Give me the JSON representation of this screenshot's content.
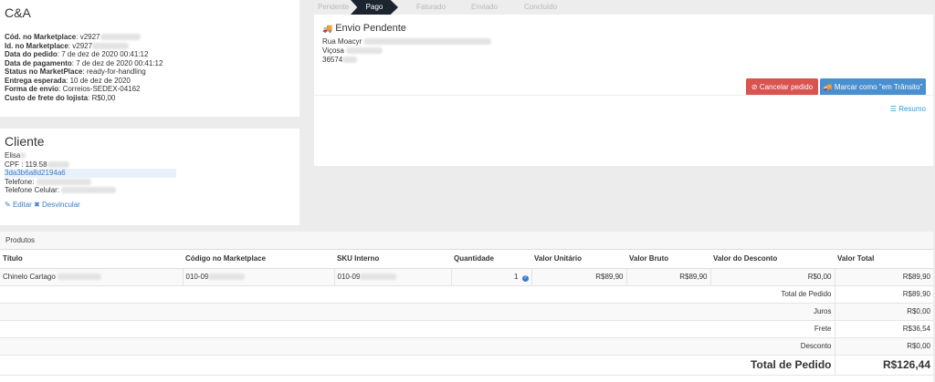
{
  "order": {
    "title": "C&A",
    "fields": [
      {
        "label": "Cód. no Marketplace",
        "value": "v2927"
      },
      {
        "label": "Id. no Marketplace",
        "value": "v2927"
      },
      {
        "label": "Data do pedido",
        "value": "7 de dez de 2020 00:41:12"
      },
      {
        "label": "Data de pagamento",
        "value": "7 de dez de 2020 00:41:12"
      },
      {
        "label": "Status no MarketPlace",
        "value": "ready-for-handling"
      },
      {
        "label": "Entrega esperada",
        "value": "10 de dez de 2020"
      },
      {
        "label": "Forma de envio",
        "value": "Correios-SEDEX-04162"
      },
      {
        "label": "Custo de frete do lojista",
        "value": "R$0,00"
      }
    ]
  },
  "client": {
    "title": "Cliente",
    "name": "Elisa",
    "cpf_label": "CPF",
    "cpf_value": "119.58",
    "id_link": "3da3b6a8d2194a6",
    "phone_label": "Telefone",
    "cell_label": "Telefone Celular",
    "edit_label": "Editar",
    "unlink_label": "Desvincular"
  },
  "steps": [
    "Pendente",
    "Pago",
    "Faturado",
    "Enviado",
    "Concluído"
  ],
  "shipping": {
    "title": "Envio Pendente",
    "address_line1": "Rua Moacyr",
    "address_line2": "Viçosa",
    "address_line3": "36574",
    "cancel_label": "Cancelar pedido",
    "transit_label": "Marcar como \"em Trânsito\"",
    "resumo_label": "Resumo"
  },
  "products": {
    "section_title": "Produtos",
    "columns": [
      "Título",
      "Código no Marketplace",
      "SKU Interno",
      "Quantidade",
      "Valor Unitário",
      "Valor Bruto",
      "Valor do Desconto",
      "Valor Total"
    ],
    "row": {
      "title": "Chinelo Cartago",
      "code": "010-09",
      "sku": "010-09",
      "qty": "1",
      "unit": "R$89,90",
      "gross": "R$89,90",
      "discount": "R$0,00",
      "total": "R$89,90"
    },
    "summary": [
      {
        "label": "Total de Pedido",
        "value": "R$89,90"
      },
      {
        "label": "Juros",
        "value": "R$0,00"
      },
      {
        "label": "Frete",
        "value": "R$36,54"
      },
      {
        "label": "Desconto",
        "value": "R$0,00"
      }
    ],
    "grand_total_label": "Total de Pedido",
    "grand_total_value": "R$126,44"
  }
}
